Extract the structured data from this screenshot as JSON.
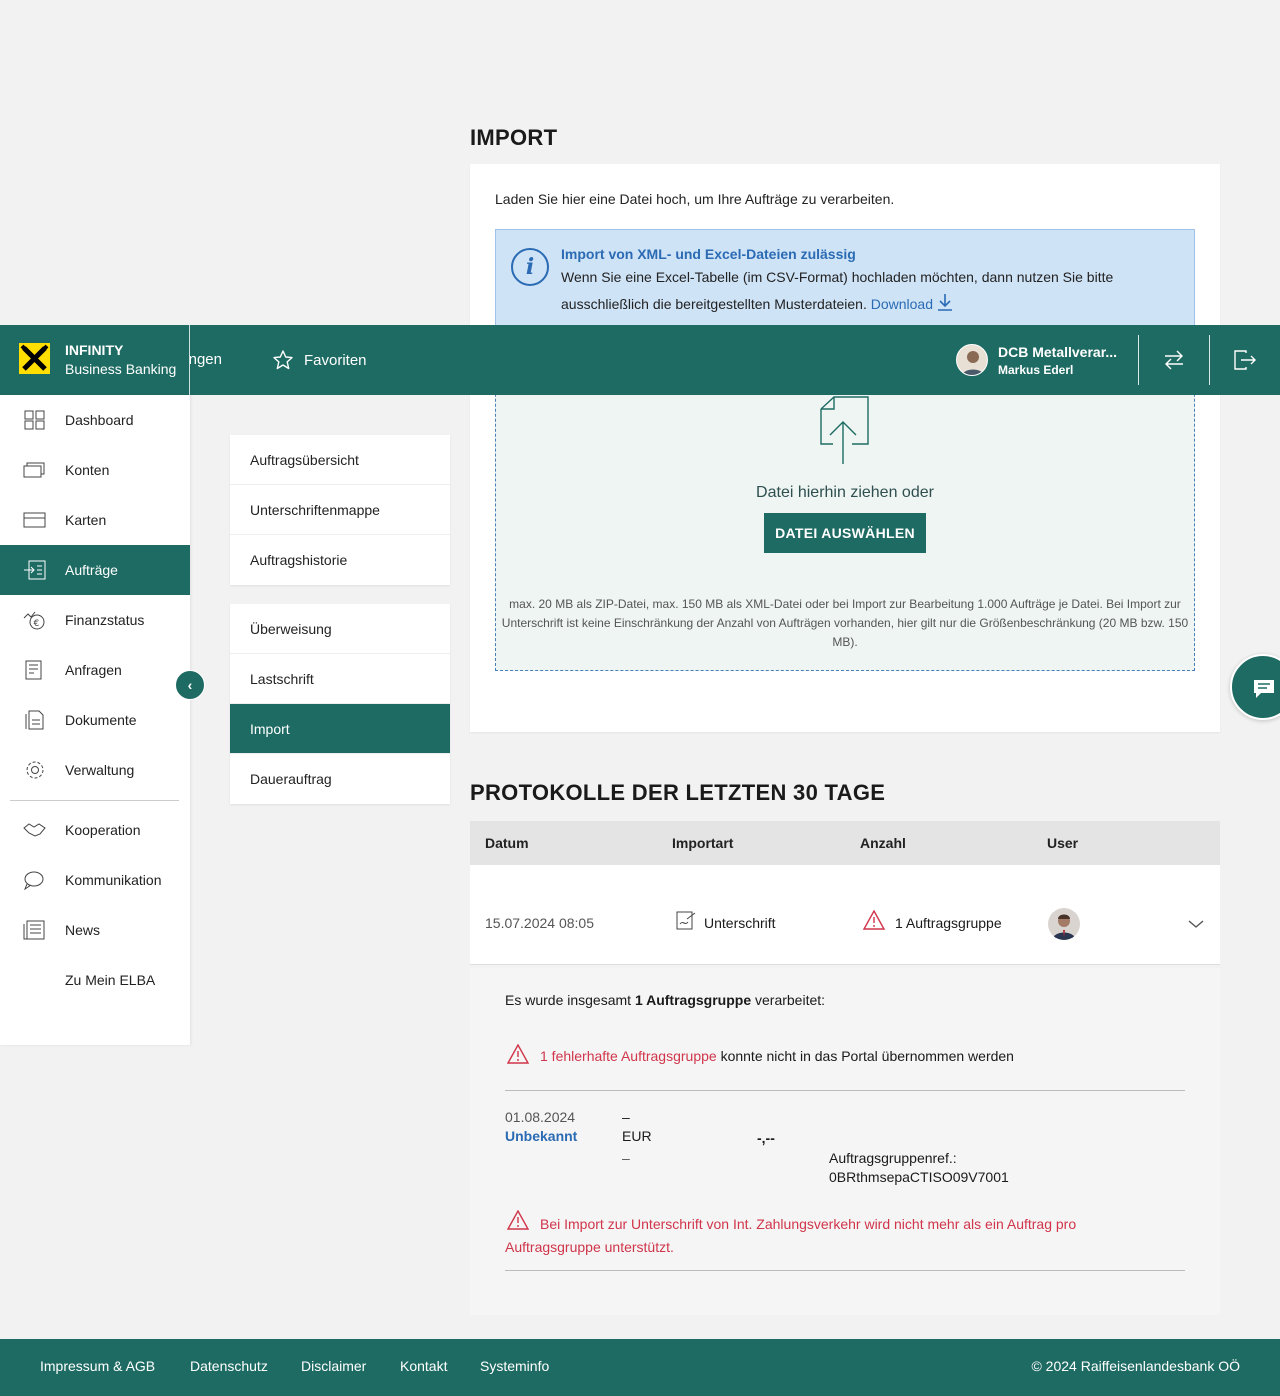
{
  "page": {
    "title": "IMPORT"
  },
  "import_card": {
    "intro": "Laden Sie hier eine Datei hoch, um Ihre Aufträge zu verarbeiten.",
    "info_title": "Import von XML- und Excel-Dateien zulässig",
    "info_text": "Wenn Sie eine Excel-Tabelle (im CSV-Format) hochladen möchten, dann nutzen Sie bitte ausschließlich die bereitgestellten Musterdateien.",
    "info_link": "Download",
    "drop_text": "Datei hierhin ziehen oder",
    "select_button": "DATEI AUSWÄHLEN",
    "hint": "max. 20 MB als ZIP-Datei, max. 150 MB als XML-Datei oder bei Import zur Bearbeitung 1.000 Aufträge je Datei. Bei Import zur Unterschrift ist keine Einschränkung der Anzahl von Aufträgen vorhanden, hier gilt nur die Größenbeschränkung (20 MB bzw. 150 MB)."
  },
  "topbar": {
    "brand_line1": "INFINITY",
    "brand_line2": "Business Banking",
    "nav_partial": "ngen",
    "favorites": "Favoriten",
    "company": "DCB Metallverar...",
    "user": "Markus Ederl"
  },
  "sidebar": {
    "items": [
      {
        "label": "Dashboard",
        "icon": "dashboard-icon"
      },
      {
        "label": "Konten",
        "icon": "accounts-icon"
      },
      {
        "label": "Karten",
        "icon": "card-icon"
      },
      {
        "label": "Aufträge",
        "icon": "orders-icon",
        "active": true
      },
      {
        "label": "Finanzstatus",
        "icon": "finance-status-icon"
      },
      {
        "label": "Anfragen",
        "icon": "requests-icon"
      },
      {
        "label": "Dokumente",
        "icon": "documents-icon"
      },
      {
        "label": "Verwaltung",
        "icon": "settings-gear-icon"
      },
      {
        "label": "Kooperation",
        "icon": "handshake-icon"
      },
      {
        "label": "Kommunikation",
        "icon": "chat-bubbles-icon"
      },
      {
        "label": "News",
        "icon": "newspaper-icon"
      },
      {
        "label": "Zu Mein ELBA"
      }
    ]
  },
  "subnav": {
    "group1": [
      "Auftragsübersicht",
      "Unterschriftenmappe",
      "Auftragshistorie"
    ],
    "group2": [
      "Überweisung",
      "Lastschrift",
      "Import",
      "Dauerauftrag"
    ],
    "active": "Import"
  },
  "protocols": {
    "title": "PROTOKOLLE DER LETZTEN 30 TAGE",
    "headers": [
      "Datum",
      "Importart",
      "Anzahl",
      "User"
    ],
    "row": {
      "date": "15.07.2024 08:05",
      "type": "Unterschrift",
      "count": "1 Auftragsgruppe"
    },
    "details": {
      "summary_pre": "Es wurde insgesamt ",
      "summary_bold": "1 Auftragsgruppe",
      "summary_post": " verarbeitet:",
      "error_highlight": "1 fehlerhafte Auftragsgruppe",
      "error_rest": " konnte nicht in das Portal übernommen werden",
      "entry_date": "01.08.2024",
      "entry_status": "Unbekannt",
      "dash1": "–",
      "currency": "EUR",
      "dash2": "–",
      "amount": "-,--",
      "ref_label": "Auftragsgruppenref.:",
      "ref_value": "0BRthmsepaCTISO09V7001",
      "warning": "Bei Import zur Unterschrift von Int. Zahlungsverkehr wird nicht mehr als ein Auftrag pro Auftragsgruppe unterstützt."
    }
  },
  "footer": {
    "links": [
      "Impressum & AGB",
      "Datenschutz",
      "Disclaimer",
      "Kontakt",
      "Systeminfo"
    ],
    "copyright": "© 2024 Raiffeisenlandesbank OÖ"
  },
  "colors": {
    "primary": "#1e6b63",
    "info_bg": "#cfe3f7",
    "info_accent": "#2a6bb3",
    "error": "#d0354a"
  }
}
